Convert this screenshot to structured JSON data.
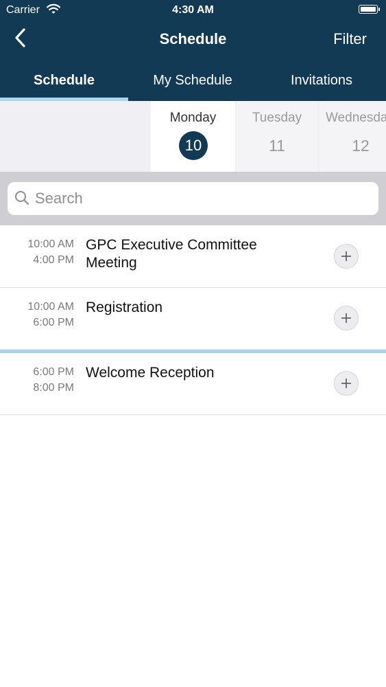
{
  "status_bar": {
    "carrier": "Carrier",
    "time": "4:30 AM"
  },
  "nav": {
    "title": "Schedule",
    "filter_label": "Filter"
  },
  "tabs": [
    {
      "label": "Schedule",
      "selected": true
    },
    {
      "label": "My Schedule",
      "selected": false
    },
    {
      "label": "Invitations",
      "selected": false
    }
  ],
  "days": [
    {
      "name": "Monday",
      "number": "10",
      "selected": true
    },
    {
      "name": "Tuesday",
      "number": "11",
      "selected": false
    },
    {
      "name": "Wednesday",
      "number": "12",
      "selected": false
    }
  ],
  "search": {
    "placeholder": "Search",
    "value": ""
  },
  "events": [
    {
      "start": "10:00 AM",
      "end": "4:00 PM",
      "title": "GPC Executive Committee Meeting"
    },
    {
      "start": "10:00 AM",
      "end": "6:00 PM",
      "title": "Registration"
    },
    {
      "start": "6:00 PM",
      "end": "8:00 PM",
      "title": "Welcome Reception"
    }
  ],
  "colors": {
    "header_background": "#123a55",
    "tab_indicator": "#a8d4ee",
    "selected_day_circle": "#123a55",
    "search_area_background": "#cfcfd3"
  },
  "icons": [
    "wifi-icon",
    "battery-icon",
    "back-chevron-icon",
    "search-icon",
    "plus-icon"
  ]
}
